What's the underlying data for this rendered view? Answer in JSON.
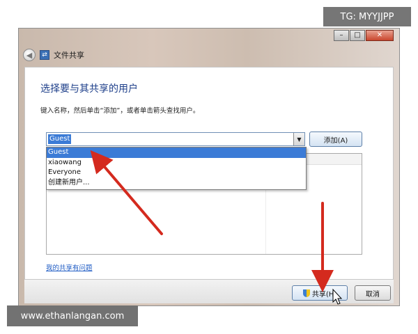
{
  "window": {
    "title": "文件共享",
    "controls": {
      "minimize": "–",
      "maximize": "□",
      "close": "✕"
    }
  },
  "main": {
    "heading": "选择要与其共享的用户",
    "instruction": "键入名称，然后单击“添加”，或者单击箭头查找用户。",
    "combo_value": "Guest",
    "add_button": "添加(A)",
    "dropdown_options": [
      "Guest",
      "xiaowang",
      "Everyone",
      "创建新用户..."
    ],
    "selected_option": "Guest",
    "help_link": "我的共享有问题"
  },
  "footer": {
    "share_button": "共享(H)",
    "cancel_button": "取消"
  },
  "watermarks": {
    "top": "TG: MYYJJPP",
    "bottom": "www.ethanlangan.com"
  },
  "colors": {
    "heading": "#1e3f8a",
    "selection": "#3b7bd6",
    "link": "#1f5cc4",
    "arrow": "#d42a1e"
  }
}
